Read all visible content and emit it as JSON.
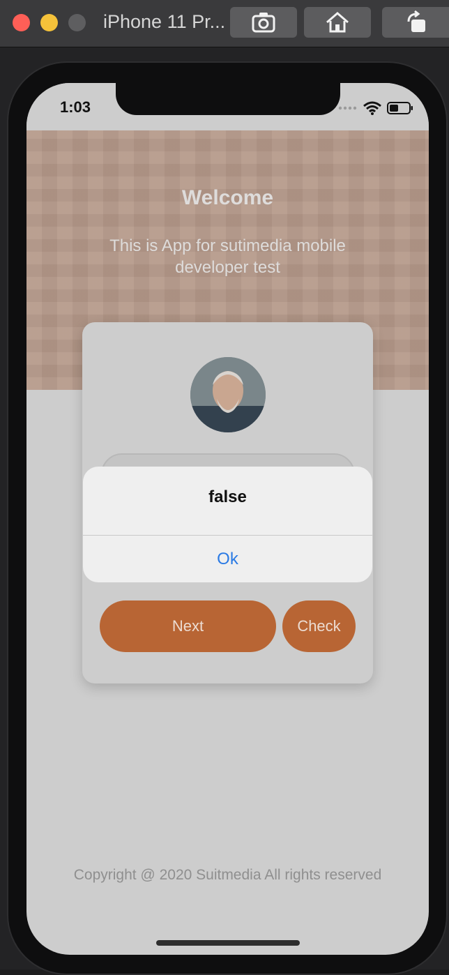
{
  "window": {
    "title": "iPhone 11 Pr..."
  },
  "status_bar": {
    "time": "1:03"
  },
  "header": {
    "title": "Welcome",
    "subtitle": "This is App for sutimedia mobile developer test"
  },
  "card": {
    "next_label": "Next",
    "check_label": "Check"
  },
  "alert": {
    "title": "false",
    "ok_label": "Ok"
  },
  "footer": {
    "copyright": "Copyright @ 2020 Suitmedia All rights reserved"
  },
  "colors": {
    "accent": "#b86534",
    "header_band": "#b69a8a",
    "link_blue": "#2a7ae4"
  },
  "icons": [
    "screenshot-icon",
    "home-icon",
    "rotate-icon",
    "wifi-icon",
    "battery-icon",
    "signal-icon"
  ]
}
